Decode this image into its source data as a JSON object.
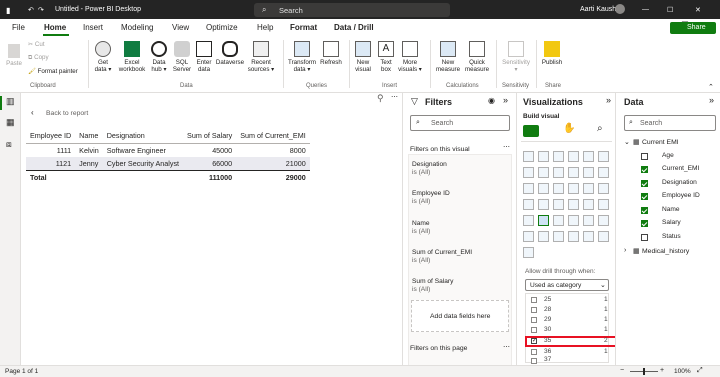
{
  "titlebar": {
    "title": "Untitled - Power BI Desktop",
    "search": "Search",
    "user": "Aarti Kaushik"
  },
  "menus": [
    "File",
    "Home",
    "Insert",
    "Modeling",
    "View",
    "Optimize",
    "Help",
    "Format",
    "Data / Drill"
  ],
  "share": "Share",
  "ribbon": {
    "clipboard": {
      "paste": "Paste",
      "cut": "Cut",
      "copy": "Copy",
      "format_painter": "Format painter",
      "group": "Clipboard"
    },
    "data": {
      "items": [
        "Get data",
        "Excel workbook",
        "Data hub",
        "SQL Server",
        "Enter data",
        "Dataverse",
        "Recent sources"
      ],
      "group": "Data"
    },
    "queries": {
      "items": [
        "Transform data",
        "Refresh"
      ],
      "group": "Queries"
    },
    "insert": {
      "items": [
        "New visual",
        "Text box",
        "More visuals"
      ],
      "group": "Insert"
    },
    "calculations": {
      "items": [
        "New measure",
        "Quick measure"
      ],
      "group": "Calculations"
    },
    "sensitivity": {
      "item": "Sensitivity",
      "group": "Sensitivity"
    },
    "share": {
      "item": "Publish",
      "group": "Share"
    }
  },
  "canvas": {
    "back": "Back to report",
    "headers": [
      "Employee ID",
      "Name",
      "Designation",
      "Sum of Salary",
      "Sum of Current_EMI"
    ],
    "rows": [
      [
        "1111",
        "Kelvin",
        "Software Engineer",
        "45000",
        "8000"
      ],
      [
        "1121",
        "Jenny",
        "Cyber Security Analyst",
        "66000",
        "21000"
      ]
    ],
    "total": [
      "Total",
      "",
      "",
      "111000",
      "29000"
    ]
  },
  "filters": {
    "title": "Filters",
    "search": "Search",
    "on_visual": "Filters on this visual",
    "cards": [
      {
        "name": "Designation",
        "value": "is (All)"
      },
      {
        "name": "Employee ID",
        "value": "is (All)"
      },
      {
        "name": "Name",
        "value": "is (All)"
      },
      {
        "name": "Sum of Current_EMI",
        "value": "is (All)"
      },
      {
        "name": "Sum of Salary",
        "value": "is (All)"
      }
    ],
    "add": "Add data fields here",
    "on_page": "Filters on this page"
  },
  "visualizations": {
    "title": "Visualizations",
    "build": "Build visual",
    "drill_label": "Allow drill through when:",
    "drill_value": "Used as category",
    "list": [
      {
        "label": "25",
        "count": "1",
        "checked": false
      },
      {
        "label": "28",
        "count": "1",
        "checked": false
      },
      {
        "label": "29",
        "count": "1",
        "checked": false
      },
      {
        "label": "30",
        "count": "1",
        "checked": false
      },
      {
        "label": "35",
        "count": "2",
        "checked": true
      },
      {
        "label": "36",
        "count": "1",
        "checked": false
      },
      {
        "label": "37",
        "count": "",
        "checked": false
      }
    ]
  },
  "data_pane": {
    "title": "Data",
    "search": "Search",
    "table": "Current EMI",
    "fields": [
      {
        "name": "Age",
        "checked": false
      },
      {
        "name": "Current_EMI",
        "checked": true
      },
      {
        "name": "Designation",
        "checked": true
      },
      {
        "name": "Employee ID",
        "checked": true
      },
      {
        "name": "Name",
        "checked": true
      },
      {
        "name": "Salary",
        "checked": true
      },
      {
        "name": "Status",
        "checked": false
      }
    ],
    "other_table": "Medical_history"
  },
  "status": {
    "page": "Page 1 of 1",
    "zoom": "100%"
  },
  "colors": {
    "accent": "#107c10",
    "titlebar": "#242424",
    "highlight": "#e81123"
  }
}
